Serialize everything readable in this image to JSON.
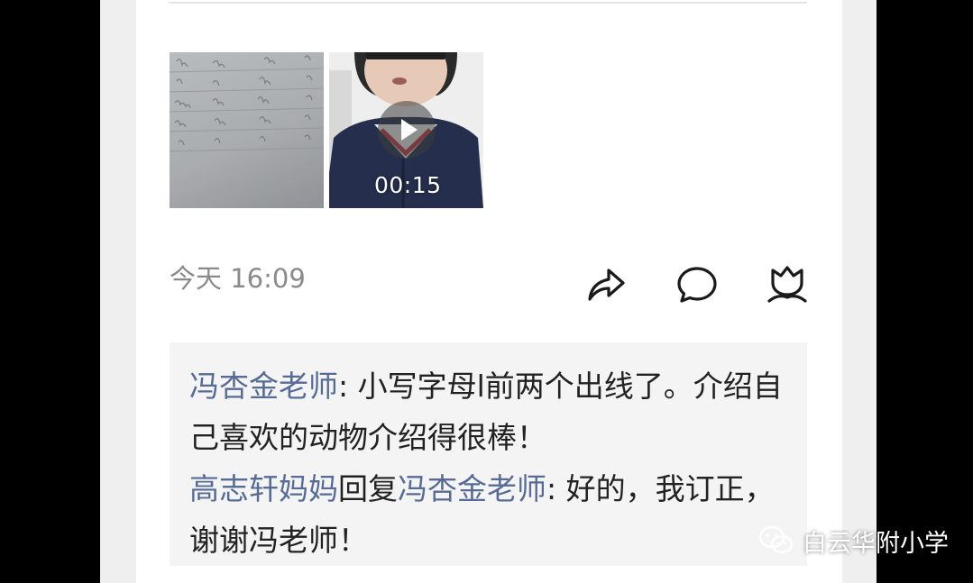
{
  "post": {
    "media": [
      {
        "type": "image",
        "icon": "handwriting-letters-photo"
      },
      {
        "type": "video",
        "duration": "00:15",
        "icon": "play-icon"
      }
    ],
    "timestamp": "今天 16:09",
    "actions": [
      {
        "icon": "share-icon"
      },
      {
        "icon": "comment-icon"
      },
      {
        "icon": "tulip-like-icon"
      }
    ]
  },
  "comments": [
    {
      "author": "冯杏金老师",
      "reply_word": "",
      "reply_to": "",
      "separator": ": ",
      "text": "小写字母l前两个出线了。介绍自己喜欢的动物介绍得很棒！"
    },
    {
      "author": "高志轩妈妈",
      "reply_word": "回复",
      "reply_to": "冯杏金老师",
      "separator": ": ",
      "text": "好的，我订正，谢谢冯老师！"
    }
  ],
  "watermark": {
    "text": "白云华附小学",
    "icon": "wechat-icon"
  },
  "colors": {
    "name_link": "#576b95",
    "comment_bg": "#f4f4f4",
    "timestamp": "#8a8a8a"
  }
}
